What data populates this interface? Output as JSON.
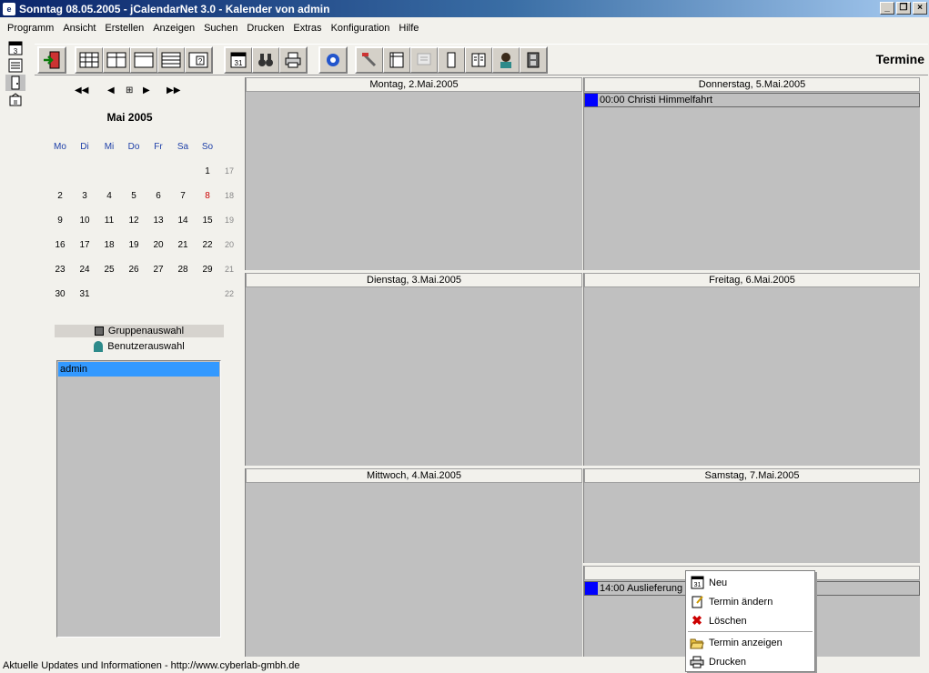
{
  "window": {
    "title": "Sonntag 08.05.2005 - jCalendarNet 3.0 - Kalender von admin"
  },
  "menu": [
    "Programm",
    "Ansicht",
    "Erstellen",
    "Anzeigen",
    "Suchen",
    "Drucken",
    "Extras",
    "Konfiguration",
    "Hilfe"
  ],
  "toolbar": {
    "title": "Termine"
  },
  "mini_calendar": {
    "month": "Mai 2005",
    "nav": {
      "prev_year": "◀◀",
      "prev_month": "◀",
      "today": "⊞",
      "next_month": "▶",
      "next_year": "▶▶"
    },
    "weekdays": [
      "Mo",
      "Di",
      "Mi",
      "Do",
      "Fr",
      "Sa",
      "So"
    ],
    "weeks": [
      {
        "kw": "17",
        "days": [
          "",
          "",
          "",
          "",
          "",
          "",
          "1"
        ]
      },
      {
        "kw": "18",
        "days": [
          "2",
          "3",
          "4",
          "5",
          "6",
          "7",
          "8"
        ]
      },
      {
        "kw": "19",
        "days": [
          "9",
          "10",
          "11",
          "12",
          "13",
          "14",
          "15"
        ]
      },
      {
        "kw": "20",
        "days": [
          "16",
          "17",
          "18",
          "19",
          "20",
          "21",
          "22"
        ]
      },
      {
        "kw": "21",
        "days": [
          "23",
          "24",
          "25",
          "26",
          "27",
          "28",
          "29"
        ]
      },
      {
        "kw": "22",
        "days": [
          "30",
          "31",
          "",
          "",
          "",
          "",
          ""
        ]
      }
    ],
    "highlight_color": "#cc0000"
  },
  "left_panel": {
    "group_tab": "Gruppenauswahl",
    "user_tab": "Benutzerauswahl",
    "users": [
      "admin"
    ]
  },
  "week": {
    "mon": {
      "label": "Montag, 2.Mai.2005"
    },
    "tue": {
      "label": "Dienstag, 3.Mai.2005"
    },
    "wed": {
      "label": "Mittwoch, 4.Mai.2005"
    },
    "thu": {
      "label": "Donnerstag, 5.Mai.2005",
      "appointments": [
        "00:00 Christi Himmelfahrt"
      ]
    },
    "fri": {
      "label": "Freitag, 6.Mai.2005"
    },
    "sat": {
      "label": "Samstag, 7.Mai.2005"
    },
    "sun": {
      "label": "",
      "appointments": [
        "14:00 Auslieferung"
      ]
    }
  },
  "context_menu": {
    "new": "Neu",
    "edit": "Termin ändern",
    "delete": "Löschen",
    "show": "Termin anzeigen",
    "print": "Drucken"
  },
  "status": "Aktuelle Updates und Informationen - http://www.cyberlab-gmbh.de",
  "colors": {
    "appointment_marker": "#0000ff",
    "selection": "#3399ff",
    "day_background": "#c0c0c0"
  }
}
